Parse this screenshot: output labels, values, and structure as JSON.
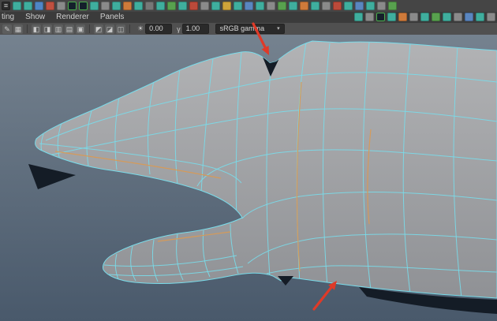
{
  "colors": {
    "wireframe": "#79dcea",
    "selected_edge": "#d89a55",
    "annotation_arrow": "#df3a28",
    "mesh_light": "#b2b3b5",
    "mesh_dark": "#8d8f93",
    "viewport_top": "#75828f",
    "viewport_bottom": "#49596b",
    "shadow": "#141c26"
  },
  "shelf": {
    "row1": [
      {
        "name": "shelf-menu",
        "color": "#2b2b2b",
        "glyph": "≡"
      },
      {
        "name": "shelf-icon",
        "color": "#3fae9e"
      },
      {
        "name": "shelf-icon",
        "color": "#3fae9e"
      },
      {
        "name": "shelf-icon",
        "color": "#4f86c6"
      },
      {
        "name": "shelf-icon",
        "color": "#c05040"
      },
      {
        "name": "shelf-icon",
        "color": "#8a8a8a"
      },
      {
        "name": "shelf-icon-highlighted",
        "color": "#15202b",
        "border": "#4cae4c"
      },
      {
        "name": "shelf-icon-highlighted",
        "color": "#15202b",
        "border": "#4cae4c"
      },
      {
        "name": "shelf-icon",
        "color": "#3fae9e"
      },
      {
        "name": "shelf-icon",
        "color": "#8a8a8a"
      },
      {
        "name": "shelf-icon",
        "color": "#3fae9e"
      },
      {
        "name": "shelf-icon",
        "color": "#cf7a3a"
      },
      {
        "name": "shelf-icon",
        "color": "#3fae9e"
      },
      {
        "name": "shelf-icon",
        "color": "#777777"
      },
      {
        "name": "shelf-icon",
        "color": "#3fae9e"
      },
      {
        "name": "shelf-icon",
        "color": "#58a14e"
      },
      {
        "name": "shelf-icon",
        "color": "#3fae9e"
      },
      {
        "name": "shelf-icon",
        "color": "#bb4a3a"
      },
      {
        "name": "shelf-icon",
        "color": "#8a8a8a"
      },
      {
        "name": "shelf-icon",
        "color": "#3fae9e"
      },
      {
        "name": "shelf-icon",
        "color": "#cfa43a"
      },
      {
        "name": "shelf-icon",
        "color": "#3fae9e"
      },
      {
        "name": "shelf-icon",
        "color": "#5a86c0"
      },
      {
        "name": "shelf-icon",
        "color": "#3fae9e"
      },
      {
        "name": "shelf-icon",
        "color": "#8a8a8a"
      },
      {
        "name": "shelf-icon",
        "color": "#58a14e"
      },
      {
        "name": "shelf-icon",
        "color": "#3fae9e"
      },
      {
        "name": "shelf-icon",
        "color": "#cf7a3a"
      },
      {
        "name": "shelf-icon",
        "color": "#3fae9e"
      },
      {
        "name": "shelf-icon",
        "color": "#8a8a8a"
      },
      {
        "name": "shelf-icon",
        "color": "#bb4a3a"
      },
      {
        "name": "shelf-icon",
        "color": "#3fae9e"
      },
      {
        "name": "shelf-icon",
        "color": "#5a86c0"
      },
      {
        "name": "shelf-icon",
        "color": "#3fae9e"
      },
      {
        "name": "shelf-icon",
        "color": "#8a8a8a"
      },
      {
        "name": "shelf-icon",
        "color": "#58a14e"
      }
    ],
    "row2_right": [
      {
        "name": "shelf-icon",
        "color": "#3fae9e"
      },
      {
        "name": "shelf-icon",
        "color": "#8a8a8a"
      },
      {
        "name": "shelf-icon-highlighted",
        "color": "#15202b",
        "border": "#4cae4c"
      },
      {
        "name": "shelf-icon",
        "color": "#3fae9e"
      },
      {
        "name": "shelf-icon",
        "color": "#cf7a3a"
      },
      {
        "name": "shelf-icon",
        "color": "#8a8a8a"
      },
      {
        "name": "shelf-icon",
        "color": "#3fae9e"
      },
      {
        "name": "shelf-icon",
        "color": "#58a14e"
      },
      {
        "name": "shelf-icon",
        "color": "#3fae9e"
      },
      {
        "name": "shelf-icon",
        "color": "#8a8a8a"
      },
      {
        "name": "shelf-icon",
        "color": "#5a86c0"
      },
      {
        "name": "shelf-icon",
        "color": "#3fae9e"
      },
      {
        "name": "shelf-icon",
        "color": "#8a8a8a"
      }
    ]
  },
  "panel_menu": {
    "items": [
      "ting",
      "Show",
      "Renderer",
      "Panels"
    ]
  },
  "viewport_toolbar": {
    "icons": [
      {
        "name": "draw-icon",
        "glyph": "✎"
      },
      {
        "name": "grid-icon",
        "glyph": "▦"
      },
      {
        "sep": true
      },
      {
        "name": "isolate-left-icon",
        "glyph": "◧"
      },
      {
        "name": "isolate-right-icon",
        "glyph": "◨"
      },
      {
        "name": "xray-icon",
        "glyph": "▥"
      },
      {
        "name": "wireframe-icon",
        "glyph": "▤"
      },
      {
        "name": "shaded-icon",
        "glyph": "▣"
      },
      {
        "sep": true
      },
      {
        "name": "textured-icon",
        "glyph": "◩"
      },
      {
        "name": "lighting-icon",
        "glyph": "◪"
      },
      {
        "name": "camera-icon",
        "glyph": "◫"
      },
      {
        "sep": true
      }
    ],
    "exposure": {
      "icon": "☀",
      "value": "0.00"
    },
    "gamma": {
      "icon": "γ",
      "value": "1.00"
    },
    "colorspace": {
      "value": "sRGB gamma",
      "caret": "▾"
    }
  },
  "viewport": {
    "annotations": [
      {
        "name": "arrow-top"
      },
      {
        "name": "arrow-bottom"
      }
    ]
  }
}
